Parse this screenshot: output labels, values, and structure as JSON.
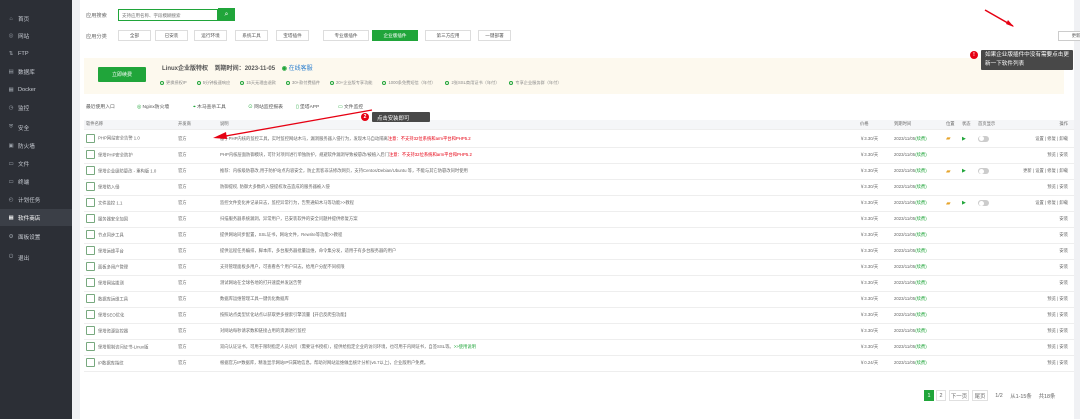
{
  "sidebar": {
    "items": [
      {
        "label": "首页",
        "icon": "home-icon",
        "glyph": "⌂"
      },
      {
        "label": "网站",
        "icon": "globe-icon",
        "glyph": "◎"
      },
      {
        "label": "FTP",
        "icon": "ftp-icon",
        "glyph": "⇅"
      },
      {
        "label": "数据库",
        "icon": "database-icon",
        "glyph": "▤"
      },
      {
        "label": "Docker",
        "icon": "docker-icon",
        "glyph": "▦"
      },
      {
        "label": "监控",
        "icon": "monitor-icon",
        "glyph": "◷"
      },
      {
        "label": "安全",
        "icon": "shield-icon",
        "glyph": "⛨"
      },
      {
        "label": "防火墙",
        "icon": "firewall-icon",
        "glyph": "▣"
      },
      {
        "label": "文件",
        "icon": "folder-icon",
        "glyph": "▭"
      },
      {
        "label": "终端",
        "icon": "terminal-icon",
        "glyph": "▭"
      },
      {
        "label": "计划任务",
        "icon": "clock-icon",
        "glyph": "◴"
      },
      {
        "label": "软件商店",
        "icon": "store-icon",
        "glyph": "▦"
      },
      {
        "label": "面板设置",
        "icon": "gear-icon",
        "glyph": "⚙"
      },
      {
        "label": "退出",
        "icon": "logout-icon",
        "glyph": "⏻"
      }
    ]
  },
  "search": {
    "label": "应用搜索",
    "placeholder": "支持应用名称、字段模糊搜索"
  },
  "categories": {
    "label": "应用分类",
    "items": [
      "全部",
      "已安装",
      "运行环境",
      "系统工具",
      "宝塔插件",
      "专业版插件",
      "企业版插件",
      "第三方应用",
      "一键部署"
    ]
  },
  "update_button": "更新软件列表 / 支付状态",
  "tip1": "如果企业版插件中没有需要点击更新一下软件列表",
  "tip2": "点击安装即可",
  "promo": {
    "buy": "立即续费",
    "title_prefix": "Linux企业版特权",
    "expiry_label": "到期时间：",
    "expiry": "2023-11-05",
    "service": "在线客服",
    "features": [
      "更换授权IP",
      "5分钟极速响应",
      "15天无理由退款",
      "30+款付费插件",
      "20+企业版专享功能",
      "1000条免费短信（年付）",
      "2张SSL商用证书（年付）",
      "专享企业服务群（年付）"
    ]
  },
  "quick": {
    "label": "最近使用入口",
    "items": [
      "Nginx防火墙",
      "木马查杀工具",
      "网站监控报表",
      "堡塔APP",
      "文件监控"
    ]
  },
  "table": {
    "headers": [
      "软件名称",
      "开发商",
      "说明",
      "价格",
      "到期时间",
      "位置",
      "状态",
      "首页显示",
      "操作"
    ],
    "rows": [
      {
        "name": "PHP网站安全告警 1.0",
        "dev": "官方",
        "desc": "基于PHP内核的监控工具，实时监控网站木马，漏洞服务器入侵行为，发现木马自动隔离",
        "note": "注意：不支持32位系统和arm平台和PHP5.2",
        "price": "￥3.30/天",
        "date": "2023/11/05",
        "tag": "(续费)",
        "pos": true,
        "ops": "设置 | 修复 | 卸载"
      },
      {
        "name": "堡塔PHP安全防护",
        "dev": "官方",
        "desc": "PHP内核层面防御模块，可针对项目进行单独防护，规避软件漏洞导致被篡改/被植入后门",
        "note": "注意：不支持32位系统和arm平台和PHP5.2",
        "price": "￥3.30/天",
        "date": "2023/11/05",
        "tag": "(续费)",
        "pos": false,
        "ops": "预览 | 安装"
      },
      {
        "name": "堡塔企业级防篡改 - 重构版 1.0",
        "dev": "官方",
        "desc": "推荐：内核级防篡改,用于防护站点内容安全，防止黑客非法修改网页，支持Centos/Debian/Ubuntu 等，不能与其它防篡改同时使用",
        "note": "",
        "price": "￥3.30/天",
        "date": "2023/11/05",
        "tag": "(续费)",
        "pos": true,
        "ops": "更新 | 设置 | 修复 | 卸载"
      },
      {
        "name": "堡塔防入侵",
        "dev": "官方",
        "desc": "防御提权, 防御大多数的入侵提权攻击造成的服务器被入侵",
        "note": "",
        "price": "￥3.30/天",
        "date": "2023/11/05",
        "tag": "(续费)",
        "pos": false,
        "ops": "预览 | 安装"
      },
      {
        "name": "文件监控 1.1",
        "dev": "官方",
        "desc": "监控文件变化并记录日志，监控异常行为，告警通知木马等功能>>教程",
        "note": "",
        "price": "￥3.30/天",
        "date": "2023/11/05",
        "tag": "(续费)",
        "pos": true,
        "ops": "设置 | 修复 | 卸载"
      },
      {
        "name": "服务器安全加固",
        "dev": "官方",
        "desc": "扫描服务器系统漏洞，异常用户，已安装软件的安全问题并提供修复方案",
        "note": "",
        "price": "￥3.30/天",
        "date": "2023/11/05",
        "tag": "(续费)",
        "pos": false,
        "ops": "安装"
      },
      {
        "name": "节点同步工具",
        "dev": "官方",
        "desc": "提供网站同步配置，SSL证书，网站文件，Rewrite等功能>>教程",
        "note": "",
        "price": "￥3.30/天",
        "date": "2023/11/05",
        "tag": "(续费)",
        "pos": false,
        "ops": "安装"
      },
      {
        "name": "堡塔运维平台",
        "dev": "官方",
        "desc": "提供远程任务编排，脚本库，多台服务器批量运维，命令集分发，适用于有多台服务器的用户",
        "note": "",
        "price": "￥3.30/天",
        "date": "2023/11/05",
        "tag": "(续费)",
        "pos": false,
        "ops": "安装"
      },
      {
        "name": "面板多用户管理",
        "dev": "官方",
        "desc": "支持管理面板多用户，可查看各个用户日志，给用户分配不同权限",
        "note": "",
        "price": "￥3.30/天",
        "date": "2023/11/05",
        "tag": "(续费)",
        "pos": false,
        "ops": "安装"
      },
      {
        "name": "堡塔网站拨测",
        "dev": "官方",
        "desc": "测试网站在全球各地的打开速度并发送告警",
        "note": "",
        "price": "￥3.30/天",
        "date": "2023/11/05",
        "tag": "(续费)",
        "pos": false,
        "ops": "安装"
      },
      {
        "name": "数据库运维工具",
        "dev": "官方",
        "desc": "数据库运维管理工具一键优化数据库",
        "note": "",
        "price": "￥3.30/天",
        "date": "2023/11/05",
        "tag": "(续费)",
        "pos": false,
        "ops": "预览 | 安装"
      },
      {
        "name": "堡塔SEO优化",
        "dev": "官方",
        "desc": "按照站点类型优化站点以获取更多搜索引擎流量【开启反爬虫功能】",
        "note": "",
        "price": "￥3.30/天",
        "date": "2023/11/05",
        "tag": "(续费)",
        "pos": false,
        "ops": "预览 | 安装"
      },
      {
        "name": "堡塔资源监控器",
        "dev": "官方",
        "desc": "对网站每秒请求数和链接占用的资源进行监控",
        "note": "",
        "price": "￥3.30/天",
        "date": "2023/11/05",
        "tag": "(续费)",
        "pos": false,
        "ops": "预览 | 安装"
      },
      {
        "name": "堡塔限制访问证书-Linux版",
        "dev": "官方",
        "desc": "双向认证证书，可用于限制指定人员访问（需要证书授权），提供给指定企业的访问环境，也可用于内网证书，自签SSL等。",
        "note": ">>使用说明",
        "price": "￥3.30/天",
        "date": "2023/11/05",
        "tag": "(续费)",
        "pos": false,
        "ops": "预览 | 安装"
      },
      {
        "name": "IP数据库指纹",
        "dev": "官方",
        "desc": "根据官方IP数据库，精准显示网站IP归属地信息，帮助对网站运维做出统计分析(v6.7以上)，企业版用户免费。",
        "note": "",
        "price": "￥0.24/天",
        "date": "2023/11/05",
        "tag": "(续费)",
        "pos": false,
        "ops": "预览 | 安装"
      }
    ]
  },
  "pagination": {
    "items": [
      "1",
      "2",
      "下一页",
      "尾页",
      "1/2",
      "从1-15条",
      "共18条"
    ]
  },
  "colors": {
    "accent": "#20a53a",
    "sidebar": "#2c2f36",
    "danger": "#e60012",
    "price": "#fc6d26"
  }
}
